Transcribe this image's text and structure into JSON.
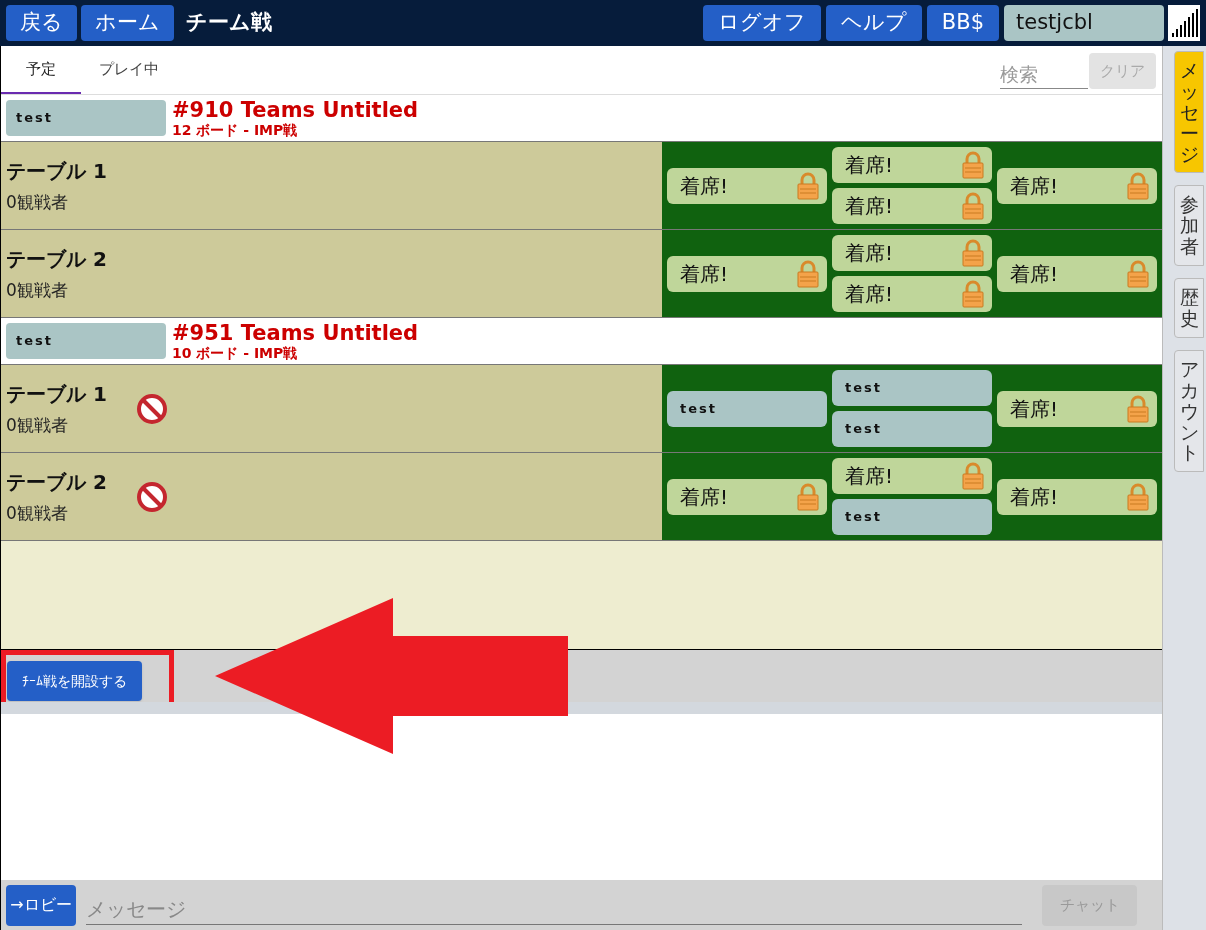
{
  "header": {
    "buttons": [
      "戻る",
      "ホーム"
    ],
    "title": "チーム戦",
    "right_buttons": [
      "ログオフ",
      "ヘルプ",
      "BB$"
    ],
    "username": "testjcbl"
  },
  "tabs": [
    {
      "label": "予定",
      "selected": true
    },
    {
      "label": "プレイ中",
      "selected": false
    }
  ],
  "search": {
    "placeholder": "検索",
    "clear": "クリア"
  },
  "tournaments": [
    {
      "host": "test",
      "title": "#910 Teams Untitled",
      "subtitle": "12 ボード - IMP戦",
      "tables": [
        {
          "name": "テーブル 1",
          "spectators": "0観戦者",
          "blocked": false,
          "seats": [
            {
              "kind": "open",
              "label": "着席!"
            },
            {
              "kind": "open",
              "label": "着席!"
            },
            {
              "kind": "open",
              "label": "着席!"
            },
            {
              "kind": "open",
              "label": "着席!"
            }
          ]
        },
        {
          "name": "テーブル 2",
          "spectators": "0観戦者",
          "blocked": false,
          "seats": [
            {
              "kind": "open",
              "label": "着席!"
            },
            {
              "kind": "open",
              "label": "着席!"
            },
            {
              "kind": "open",
              "label": "着席!"
            },
            {
              "kind": "open",
              "label": "着席!"
            }
          ]
        }
      ]
    },
    {
      "host": "test",
      "title": "#951 Teams Untitled",
      "subtitle": "10 ボード - IMP戦",
      "tables": [
        {
          "name": "テーブル 1",
          "spectators": "0観戦者",
          "blocked": true,
          "seats": [
            {
              "kind": "taken",
              "label": "test"
            },
            {
              "kind": "taken",
              "label": "test"
            },
            {
              "kind": "taken",
              "label": "test"
            },
            {
              "kind": "open",
              "label": "着席!"
            }
          ]
        },
        {
          "name": "テーブル 2",
          "spectators": "0観戦者",
          "blocked": true,
          "seats": [
            {
              "kind": "open",
              "label": "着席!"
            },
            {
              "kind": "open",
              "label": "着席!"
            },
            {
              "kind": "taken",
              "label": "test"
            },
            {
              "kind": "open",
              "label": "着席!"
            }
          ]
        }
      ]
    }
  ],
  "create_button": "ﾁｰﾑ戦を開設する",
  "chat": {
    "lobby_button": "→ロビー",
    "placeholder": "メッセージ",
    "send_button": "チャット"
  },
  "side_tabs": [
    {
      "label": "メッセージ",
      "selected": true
    },
    {
      "label": "参加者",
      "selected": false
    },
    {
      "label": "歴史",
      "selected": false
    },
    {
      "label": "アカウント",
      "selected": false
    }
  ]
}
